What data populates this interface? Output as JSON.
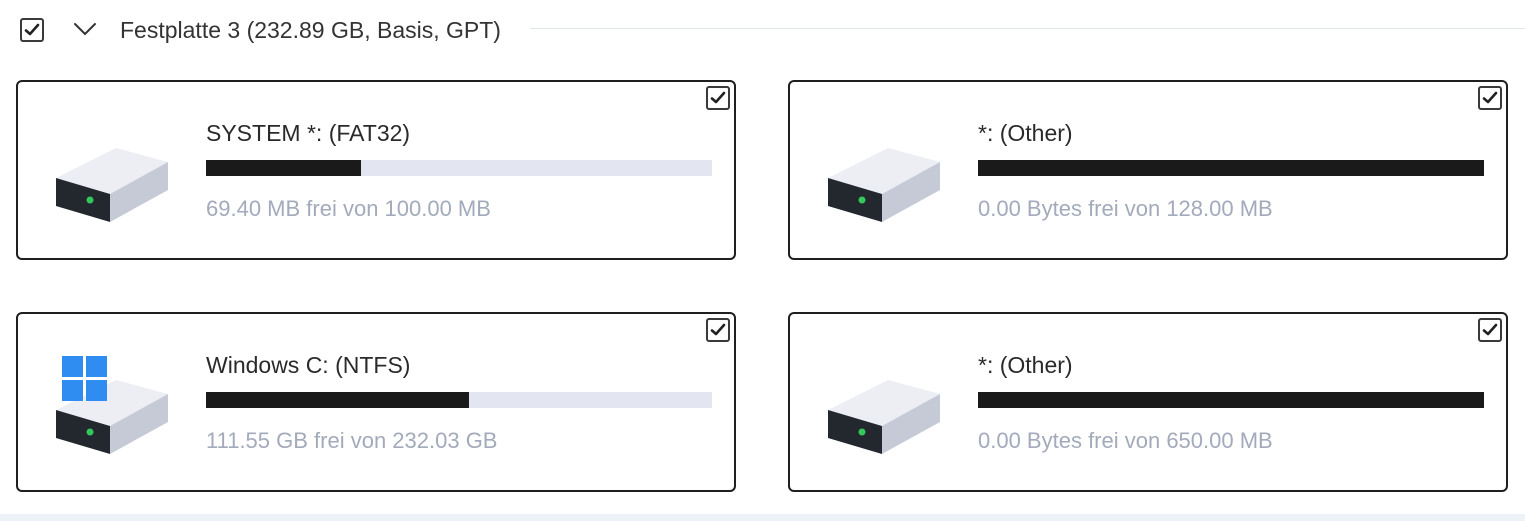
{
  "disk": {
    "title": "Festplatte 3 (232.89 GB, Basis, GPT)",
    "checked": true,
    "expanded": true
  },
  "partitions": [
    {
      "name": "SYSTEM *: (FAT32)",
      "free_text": "69.40 MB frei von 100.00 MB",
      "used_fraction": 0.306,
      "checked": true,
      "icon": "drive-icon"
    },
    {
      "name": "*: (Other)",
      "free_text": "0.00 Bytes frei von 128.00 MB",
      "used_fraction": 1.0,
      "checked": true,
      "icon": "drive-icon"
    },
    {
      "name": "Windows C: (NTFS)",
      "free_text": "111.55 GB frei von 232.03 GB",
      "used_fraction": 0.519,
      "checked": true,
      "icon": "windows-drive-icon"
    },
    {
      "name": "*: (Other)",
      "free_text": "0.00 Bytes frei von 650.00 MB",
      "used_fraction": 1.0,
      "checked": true,
      "icon": "drive-icon"
    }
  ],
  "colors": {
    "bar_used": "#1a1a1a",
    "bar_free": "#e3e6f1",
    "free_text": "#a3aabb",
    "windows_blue": "#2f8cf0"
  }
}
